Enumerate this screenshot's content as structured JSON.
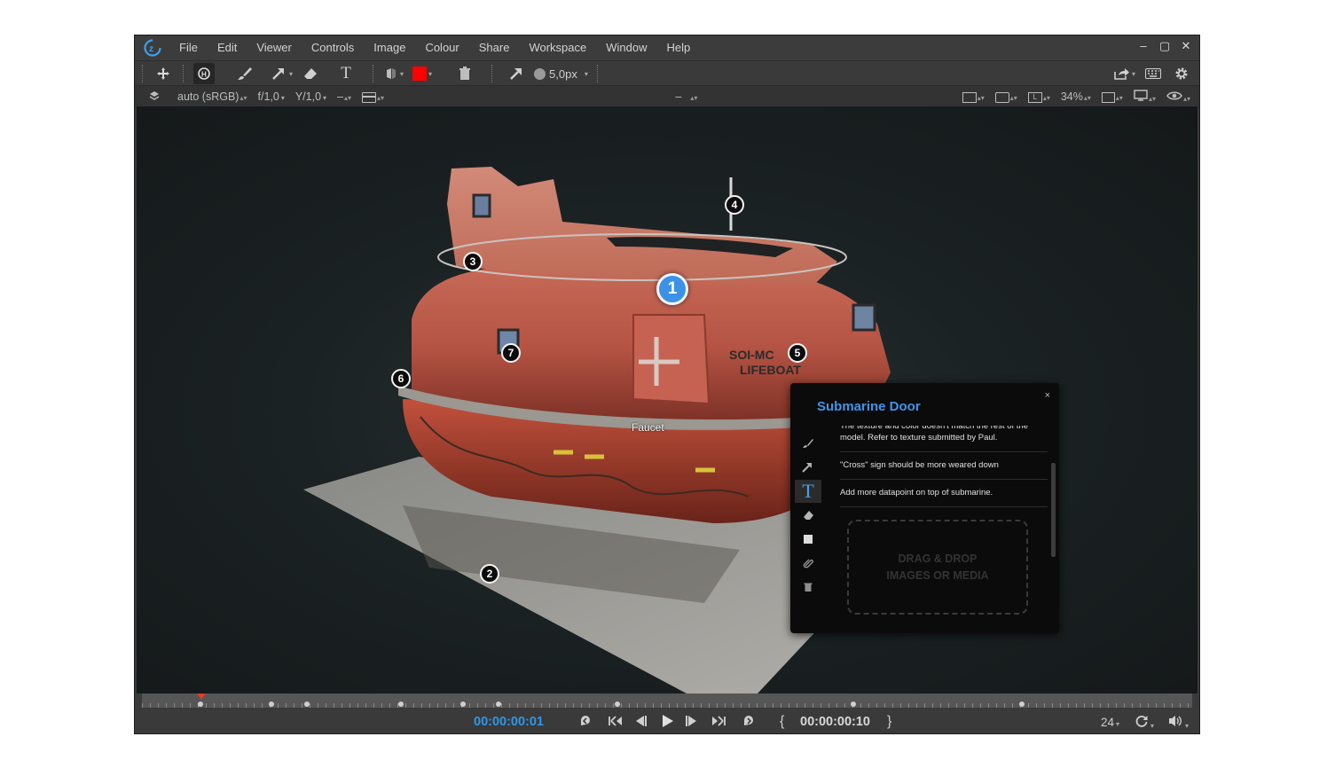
{
  "menu": {
    "items": [
      "File",
      "Edit",
      "Viewer",
      "Controls",
      "Image",
      "Colour",
      "Share",
      "Workspace",
      "Window",
      "Help"
    ]
  },
  "window_controls": {
    "minimize": "–",
    "maximize": "▢",
    "close": "✕"
  },
  "toolbar": {
    "brush_size": "5,0px",
    "annotation_color": "#ff0000"
  },
  "viewer_bar": {
    "color_space": "auto (sRGB)",
    "fstop": "f/1,0",
    "gamma": "Y/1,0",
    "channel": "–",
    "center_channel": "–",
    "zoom": "34%"
  },
  "markers": [
    {
      "label": "1",
      "active": true
    },
    {
      "label": "2"
    },
    {
      "label": "3"
    },
    {
      "label": "4"
    },
    {
      "label": "5"
    },
    {
      "label": "6"
    },
    {
      "label": "7"
    }
  ],
  "viewport_label": "Faucet",
  "note_panel": {
    "title": "Submarine Door",
    "close": "×",
    "notes": [
      "The texture and color doesn't match the rest of the model. Refer to texture submitted by Paul.",
      "\"Cross\" sign should be more weared down",
      "Add more datapoint on top of submarine."
    ],
    "dropzone_line1": "DRAG & DROP",
    "dropzone_line2": "IMAGES OR MEDIA"
  },
  "timeline": {
    "current_timecode": "00:00:00:01",
    "end_timecode": "00:00:00:10",
    "fps": "24",
    "in_bracket": "{",
    "out_bracket": "}"
  },
  "colors": {
    "accent": "#3f95ea",
    "playhead": "#e23b2a",
    "timecode": "#2f97e8"
  }
}
